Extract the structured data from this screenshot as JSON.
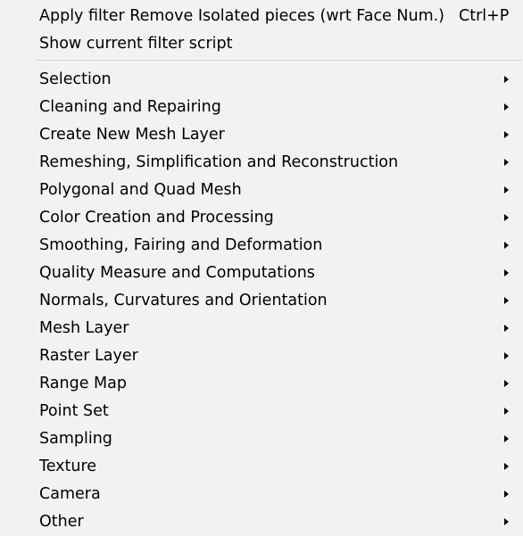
{
  "menu": {
    "top_items": [
      {
        "label": "Apply filter Remove Isolated pieces (wrt Face Num.)",
        "shortcut": "Ctrl+P"
      },
      {
        "label": "Show current filter script",
        "shortcut": ""
      }
    ],
    "submenus": [
      {
        "label": "Selection",
        "icon": "chevron-right-icon"
      },
      {
        "label": "Cleaning and Repairing",
        "icon": "chevron-right-icon"
      },
      {
        "label": "Create New Mesh Layer",
        "icon": "chevron-right-icon"
      },
      {
        "label": "Remeshing, Simplification and Reconstruction",
        "icon": "chevron-right-icon"
      },
      {
        "label": "Polygonal and Quad Mesh",
        "icon": "chevron-right-icon"
      },
      {
        "label": "Color Creation and Processing",
        "icon": "chevron-right-icon"
      },
      {
        "label": "Smoothing, Fairing and Deformation",
        "icon": "chevron-right-icon"
      },
      {
        "label": "Quality Measure and Computations",
        "icon": "chevron-right-icon"
      },
      {
        "label": "Normals, Curvatures and Orientation",
        "icon": "chevron-right-icon"
      },
      {
        "label": "Mesh Layer",
        "icon": "chevron-right-icon"
      },
      {
        "label": "Raster Layer",
        "icon": "chevron-right-icon"
      },
      {
        "label": "Range Map",
        "icon": "chevron-right-icon"
      },
      {
        "label": "Point Set",
        "icon": "chevron-right-icon"
      },
      {
        "label": "Sampling",
        "icon": "chevron-right-icon"
      },
      {
        "label": "Texture",
        "icon": "chevron-right-icon"
      },
      {
        "label": "Camera",
        "icon": "chevron-right-icon"
      },
      {
        "label": "Other",
        "icon": "chevron-right-icon"
      }
    ],
    "colors": {
      "background": "#f2f2f2",
      "text": "#000000",
      "separator": "#d7d7d7"
    }
  }
}
